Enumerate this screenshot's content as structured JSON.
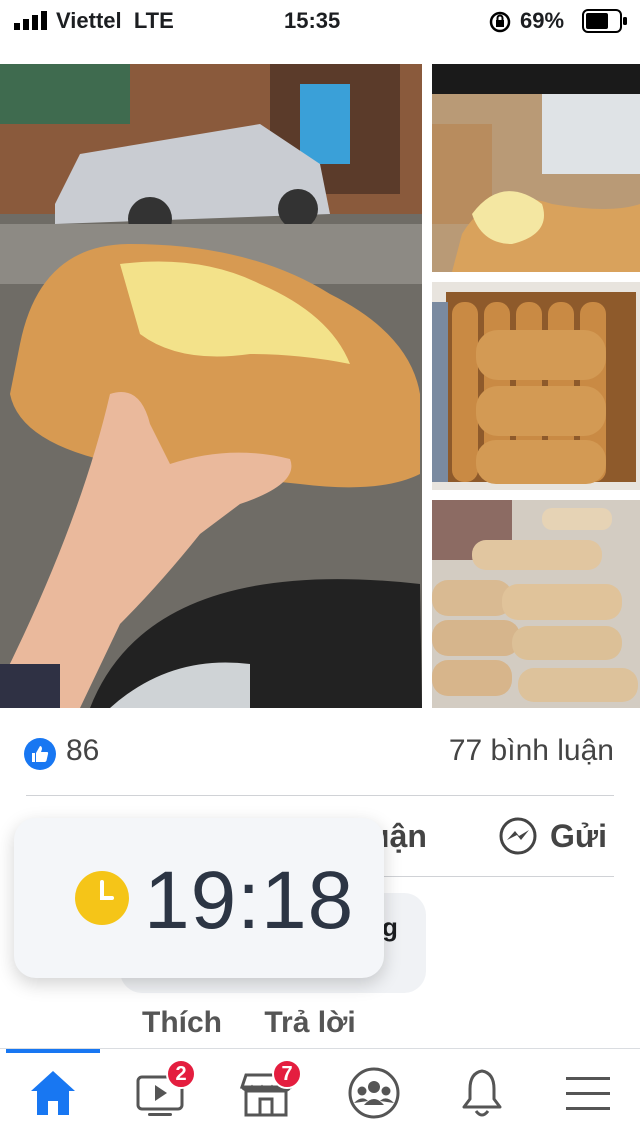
{
  "status_bar": {
    "carrier": "Viettel",
    "network": "LTE",
    "time": "15:35",
    "battery_percent": "69%",
    "battery_level": 0.69,
    "icons": [
      "signal-icon",
      "rotation-lock-icon",
      "battery-icon"
    ]
  },
  "post": {
    "photos": [
      {
        "name": "photo-main",
        "description": ""
      },
      {
        "name": "photo-2"
      },
      {
        "name": "photo-3"
      },
      {
        "name": "photo-4"
      }
    ],
    "like_count": "86",
    "comment_count": "77 bình luận",
    "actions": {
      "comment_label_partial": "uận",
      "send_label": "Gửi"
    },
    "comment_partial_text": "g",
    "comment_actions": {
      "like": "Thích",
      "reply": "Trả lời"
    }
  },
  "clock_overlay": {
    "time": "19:18"
  },
  "tabbar": {
    "items": [
      {
        "name": "home",
        "icon": "home-icon",
        "active": true
      },
      {
        "name": "watch",
        "icon": "video-icon",
        "badge": "2"
      },
      {
        "name": "marketplace",
        "icon": "store-icon",
        "badge": "7"
      },
      {
        "name": "groups",
        "icon": "groups-icon"
      },
      {
        "name": "notifications",
        "icon": "bell-icon"
      },
      {
        "name": "menu",
        "icon": "hamburger-icon"
      }
    ]
  },
  "colors": {
    "accent": "#1877f2",
    "badge": "#e41e3f",
    "clock_icon": "#f5c518"
  }
}
